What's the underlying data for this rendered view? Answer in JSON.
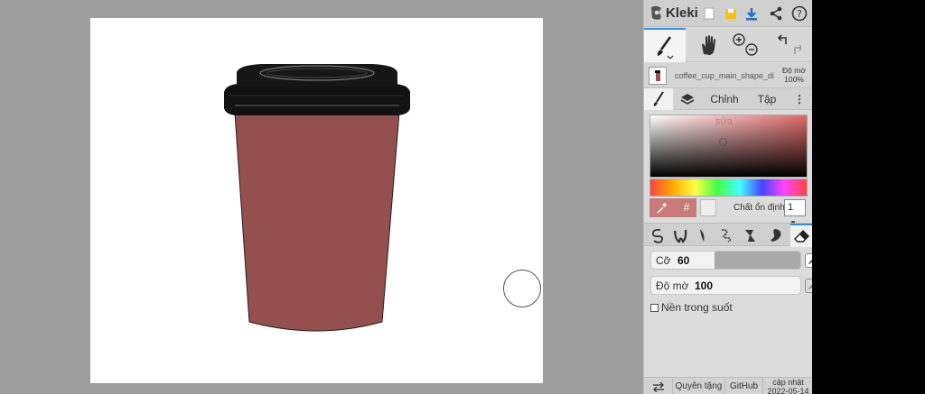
{
  "app": {
    "name": "Kleki"
  },
  "topbar": {
    "icons": [
      "new-file-icon",
      "save-icon",
      "download-icon",
      "share-icon",
      "help-icon"
    ],
    "help_glyph": "?"
  },
  "tools": [
    "brush-tool",
    "hand-tool",
    "zoom-tool",
    "undo-redo"
  ],
  "layer": {
    "name": "coffee_cup_main_shape_di",
    "opacity_label": "Độ mờ",
    "opacity_value": "100%"
  },
  "tabs": {
    "adjust": "Chỉnh",
    "file": "Tập",
    "more": "⋮"
  },
  "color": {
    "sv_hint_left": "sửa",
    "sv_hint_right": "tin",
    "current": "#c97b7b",
    "hash": "#",
    "stabilizer_label": "Chất ổn định",
    "stabilizer_value": "1"
  },
  "brush": {
    "size_label": "Cỡ",
    "size_value": "60",
    "opacity_label": "Độ mờ",
    "opacity_value": "100",
    "transparent_bg_label": "Nền trong suốt",
    "selected": "eraser"
  },
  "footer": {
    "donate": "Quyên tặng",
    "github": "GitHub",
    "update_line1": "cập nhật",
    "update_line2": "2022-05-14"
  },
  "canvas": {
    "cup_body_color": "#944f4f",
    "lid_color": "#111111"
  }
}
